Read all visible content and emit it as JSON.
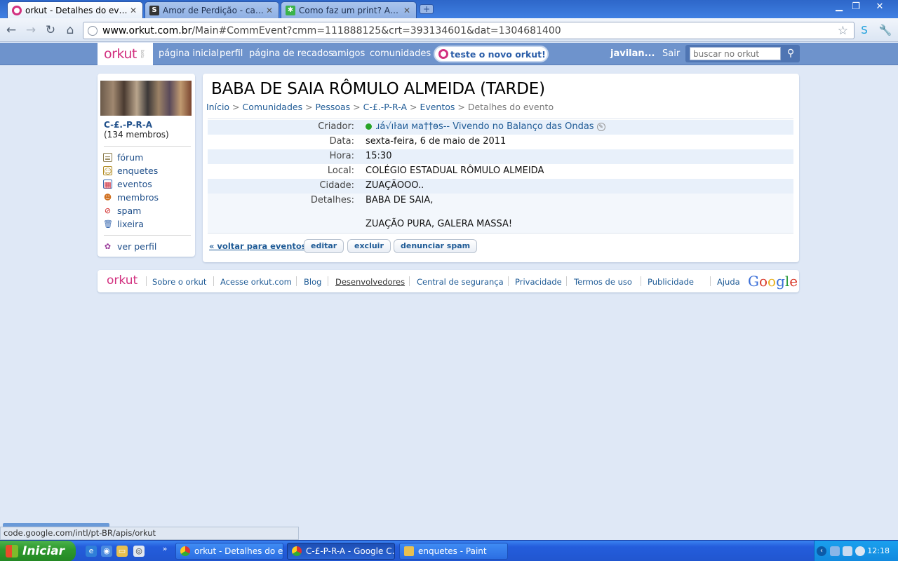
{
  "browser": {
    "tabs": [
      {
        "title": "orkut - Detalhes do evento",
        "active": true
      },
      {
        "title": "Amor de Perdição - caracte…",
        "active": false
      },
      {
        "title": "Como faz um print? Akeles …",
        "active": false
      }
    ],
    "url_host": "www.orkut.com.br",
    "url_path": "/Main#CommEvent?cmm=111888125&crt=393134601&dat=1304681400"
  },
  "orkut_header": {
    "logo": "orkut",
    "nav": [
      "página inicial",
      "perfil",
      "página de recados",
      "amigos",
      "comunidades"
    ],
    "new_orkut": "teste o novo orkut!",
    "user": "javilan...",
    "logout": "Sair",
    "search_placeholder": "buscar no orkut"
  },
  "community": {
    "name": "C-£.-P-R-A",
    "members": "(134 membros)",
    "menu": [
      {
        "label": "fórum",
        "icon": "forum-icon"
      },
      {
        "label": "enquetes",
        "icon": "poll-icon"
      },
      {
        "label": "eventos",
        "icon": "calendar-icon"
      },
      {
        "label": "membros",
        "icon": "members-icon"
      },
      {
        "label": "spam",
        "icon": "spam-icon"
      },
      {
        "label": "lixeira",
        "icon": "trash-icon"
      }
    ],
    "profile_link": "ver perfil"
  },
  "event": {
    "title": "BABA DE SAIA RÔMULO ALMEIDA (TARDE)",
    "breadcrumb": [
      "Início",
      "Comunidades",
      "Pessoas",
      "C-£.-P-R-A",
      "Eventos",
      "Detalhes do evento"
    ],
    "fields": {
      "creator_label": "Criador:",
      "creator_value": "ɹá√ıŀaи мa††ɵs-- Vivendo no Balanço das Ondas",
      "date_label": "Data:",
      "date_value": "sexta-feira, 6 de maio de 2011",
      "time_label": "Hora:",
      "time_value": "15:30",
      "place_label": "Local:",
      "place_value": "COLÉGIO ESTADUAL RÔMULO ALMEIDA",
      "city_label": "Cidade:",
      "city_value": "ZUAÇÃOOO..",
      "details_label": "Detalhes:",
      "details_line1": "BABA DE SAIA,",
      "details_line2": "ZUAÇÃO PURA, GALERA MASSA!"
    },
    "actions": {
      "back": "« voltar para eventos",
      "edit": "editar",
      "delete": "excluir",
      "report": "denunciar spam"
    }
  },
  "footer": {
    "logo": "orkut",
    "links": [
      "Sobre o orkut",
      "Acesse orkut.com",
      "Blog",
      "Desenvolvedores",
      "Central de segurança",
      "Privacidade",
      "Termos de uso",
      "Publicidade",
      "Ajuda"
    ],
    "google": "Google"
  },
  "status_bar": "code.google.com/intl/pt-BR/apis/orkut",
  "taskbar": {
    "start": "Iniciar",
    "tasks": [
      {
        "title": "orkut - Detalhes do e..."
      },
      {
        "title": "C-£-P-R-A - Google C..."
      },
      {
        "title": "enquetes - Paint"
      }
    ],
    "clock": "12:18"
  }
}
